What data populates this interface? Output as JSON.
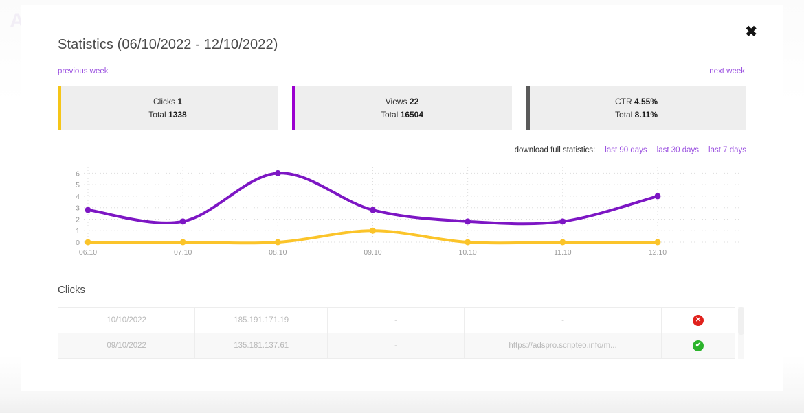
{
  "modal": {
    "title": "Statistics (06/10/2022 - 12/10/2022)",
    "close_label": "✖"
  },
  "nav": {
    "previous": "previous week",
    "next": "next week"
  },
  "cards": [
    {
      "name": "clicks",
      "label": "Clicks",
      "value": "1",
      "total_label": "Total",
      "total_value": "1338",
      "accent": "#f5c518"
    },
    {
      "name": "views",
      "label": "Views",
      "value": "22",
      "total_label": "Total",
      "total_value": "16504",
      "accent": "#9b00cf"
    },
    {
      "name": "ctr",
      "label": "CTR",
      "value": "4.55%",
      "total_label": "Total",
      "total_value": "8.11%",
      "accent": "#5a5a5a"
    }
  ],
  "download": {
    "label": "download full statistics:",
    "links": [
      "last 90 days",
      "last 30 days",
      "last 7 days"
    ]
  },
  "chart_data": {
    "type": "line",
    "title": "",
    "xlabel": "",
    "ylabel": "",
    "x": [
      "06.10",
      "07.10",
      "08.10",
      "09.10",
      "10.10",
      "11.10",
      "12.10"
    ],
    "categories": [
      "06.10",
      "07.10",
      "08.10",
      "09.10",
      "10.10",
      "11.10",
      "12.10"
    ],
    "yticks": [
      0,
      1,
      2,
      3,
      4,
      5,
      6
    ],
    "ylim": [
      0,
      6.5
    ],
    "grid": true,
    "legend": "none",
    "series": [
      {
        "name": "Views",
        "color": "#7d16c4",
        "values": [
          2.8,
          1.8,
          6.0,
          2.8,
          1.8,
          1.8,
          4.0
        ]
      },
      {
        "name": "Clicks",
        "color": "#fbc42a",
        "values": [
          0,
          0,
          0,
          1.0,
          0,
          0,
          0
        ]
      }
    ]
  },
  "clicks_section": {
    "title": "Clicks",
    "rows": [
      {
        "date": "10/10/2022",
        "ip": "185.191.171.19",
        "col3": "-",
        "col4": "-",
        "status": "fail",
        "status_glyph": "✕"
      },
      {
        "date": "09/10/2022",
        "ip": "135.181.137.61",
        "col3": "-",
        "col4": "https://adspro.scripteo.info/m...",
        "status": "ok",
        "status_glyph": "✔"
      }
    ]
  },
  "watermark": "ADS"
}
